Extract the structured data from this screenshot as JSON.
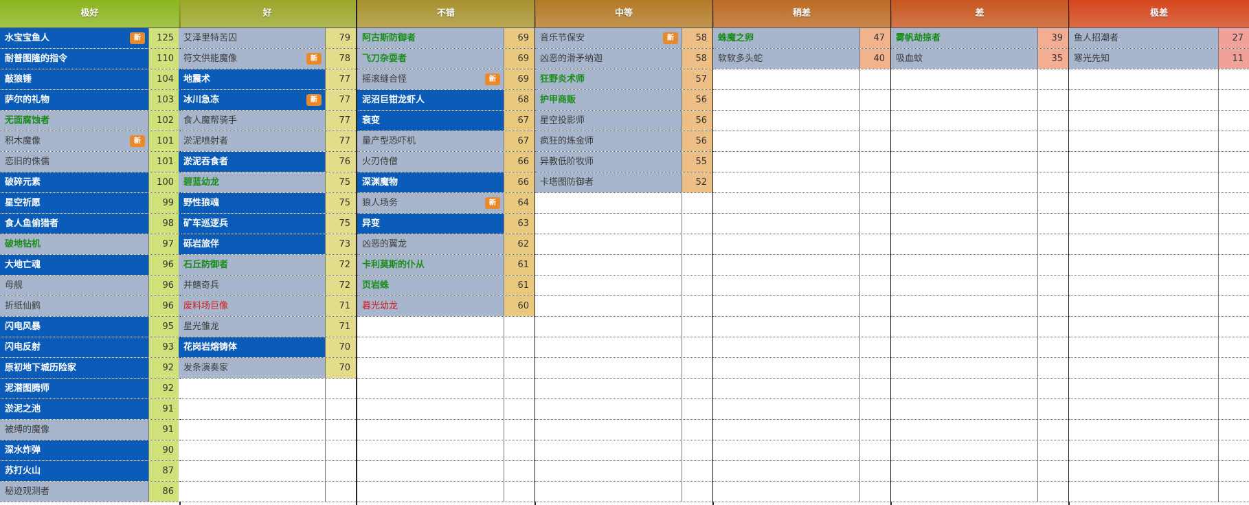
{
  "tiers": [
    {
      "label": "极好",
      "header_color": "#8cb51f",
      "score_bg": "#cfe27a",
      "items": [
        {
          "name": "水宝宝鱼人",
          "score": "125",
          "style": "blue",
          "color": "white",
          "new": true
        },
        {
          "name": "耐普图隆的指令",
          "score": "110",
          "style": "blue",
          "color": "white",
          "new": false
        },
        {
          "name": "敲狼锤",
          "score": "104",
          "style": "blue",
          "color": "white",
          "new": false
        },
        {
          "name": "萨尔的礼物",
          "score": "103",
          "style": "blue",
          "color": "white",
          "new": false
        },
        {
          "name": "无面腐蚀者",
          "score": "102",
          "style": "gray",
          "color": "green",
          "new": false
        },
        {
          "name": "积木魔像",
          "score": "101",
          "style": "gray",
          "color": "dark",
          "new": true
        },
        {
          "name": "恋旧的侏儒",
          "score": "101",
          "style": "gray",
          "color": "dark",
          "new": false
        },
        {
          "name": "破碎元素",
          "score": "100",
          "style": "blue",
          "color": "white",
          "new": false
        },
        {
          "name": "星空祈愿",
          "score": "99",
          "style": "blue",
          "color": "white",
          "new": false
        },
        {
          "name": "食人鱼偷猎者",
          "score": "98",
          "style": "blue",
          "color": "white",
          "new": false
        },
        {
          "name": "破地钻机",
          "score": "97",
          "style": "gray",
          "color": "green",
          "new": false
        },
        {
          "name": "大地亡魂",
          "score": "96",
          "style": "blue",
          "color": "white",
          "new": false
        },
        {
          "name": "母舰",
          "score": "96",
          "style": "gray",
          "color": "dark",
          "new": false
        },
        {
          "name": "折纸仙鹤",
          "score": "96",
          "style": "gray",
          "color": "dark",
          "new": false
        },
        {
          "name": "闪电风暴",
          "score": "95",
          "style": "blue",
          "color": "white",
          "new": false
        },
        {
          "name": "闪电反射",
          "score": "93",
          "style": "blue",
          "color": "white",
          "new": false
        },
        {
          "name": "原初地下城历险家",
          "score": "92",
          "style": "blue",
          "color": "white",
          "new": false
        },
        {
          "name": "泥潜图腾师",
          "score": "92",
          "style": "blue",
          "color": "white",
          "new": false
        },
        {
          "name": "淤泥之池",
          "score": "91",
          "style": "blue",
          "color": "white",
          "new": false
        },
        {
          "name": "被缚的魔像",
          "score": "91",
          "style": "gray",
          "color": "dark",
          "new": false
        },
        {
          "name": "深水炸弹",
          "score": "90",
          "style": "blue",
          "color": "white",
          "new": false
        },
        {
          "name": "苏打火山",
          "score": "87",
          "style": "blue",
          "color": "white",
          "new": false
        },
        {
          "name": "秘迹观测者",
          "score": "86",
          "style": "gray",
          "color": "dark",
          "new": false
        }
      ]
    },
    {
      "label": "好",
      "header_color": "#9aa62a",
      "score_bg": "#e3dc8a",
      "items": [
        {
          "name": "艾泽里特苦囚",
          "score": "79",
          "style": "gray",
          "color": "dark",
          "new": false
        },
        {
          "name": "符文供能魔像",
          "score": "78",
          "style": "gray",
          "color": "dark",
          "new": true
        },
        {
          "name": "地震术",
          "score": "77",
          "style": "blue",
          "color": "white",
          "new": false
        },
        {
          "name": "冰川急冻",
          "score": "77",
          "style": "blue",
          "color": "white",
          "new": true
        },
        {
          "name": "食人魔帮骑手",
          "score": "77",
          "style": "gray",
          "color": "dark",
          "new": false
        },
        {
          "name": "淤泥喷射者",
          "score": "77",
          "style": "gray",
          "color": "dark",
          "new": false
        },
        {
          "name": "淤泥吞食者",
          "score": "76",
          "style": "blue",
          "color": "white",
          "new": false
        },
        {
          "name": "碧蓝幼龙",
          "score": "75",
          "style": "gray",
          "color": "green",
          "new": false
        },
        {
          "name": "野性狼魂",
          "score": "75",
          "style": "blue",
          "color": "white",
          "new": false
        },
        {
          "name": "矿车巡逻兵",
          "score": "75",
          "style": "blue",
          "color": "white",
          "new": false
        },
        {
          "name": "砾岩旅伴",
          "score": "73",
          "style": "blue",
          "color": "white",
          "new": false
        },
        {
          "name": "石丘防御者",
          "score": "72",
          "style": "gray",
          "color": "green",
          "new": false
        },
        {
          "name": "并鳍奇兵",
          "score": "72",
          "style": "gray",
          "color": "dark",
          "new": false
        },
        {
          "name": "废料场巨像",
          "score": "71",
          "style": "gray",
          "color": "red",
          "new": false
        },
        {
          "name": "星光雏龙",
          "score": "71",
          "style": "gray",
          "color": "dark",
          "new": false
        },
        {
          "name": "花岗岩熔铸体",
          "score": "70",
          "style": "blue",
          "color": "white",
          "new": false
        },
        {
          "name": "发条演奏家",
          "score": "70",
          "style": "gray",
          "color": "dark",
          "new": false
        }
      ]
    },
    {
      "label": "不错",
      "header_color": "#a8922e",
      "score_bg": "#e9c97e",
      "items": [
        {
          "name": "阿古斯防御者",
          "score": "69",
          "style": "gray",
          "color": "green",
          "new": false
        },
        {
          "name": "飞刀杂耍者",
          "score": "69",
          "style": "gray",
          "color": "green",
          "new": false
        },
        {
          "name": "摇滚缝合怪",
          "score": "69",
          "style": "gray",
          "color": "dark",
          "new": true
        },
        {
          "name": "泥沼巨钳龙虾人",
          "score": "68",
          "style": "blue",
          "color": "white",
          "new": false
        },
        {
          "name": "衰变",
          "score": "67",
          "style": "blue",
          "color": "white",
          "new": false
        },
        {
          "name": "量产型恐吓机",
          "score": "67",
          "style": "gray",
          "color": "dark",
          "new": false
        },
        {
          "name": "火刃侍僧",
          "score": "66",
          "style": "gray",
          "color": "dark",
          "new": false
        },
        {
          "name": "深渊魔物",
          "score": "66",
          "style": "blue",
          "color": "white",
          "new": false
        },
        {
          "name": "狼人场务",
          "score": "64",
          "style": "gray",
          "color": "dark",
          "new": true
        },
        {
          "name": "异变",
          "score": "63",
          "style": "blue",
          "color": "white",
          "new": false
        },
        {
          "name": "凶恶的翼龙",
          "score": "62",
          "style": "gray",
          "color": "dark",
          "new": false
        },
        {
          "name": "卡利莫斯的仆从",
          "score": "61",
          "style": "gray",
          "color": "green",
          "new": false
        },
        {
          "name": "页岩蛛",
          "score": "61",
          "style": "gray",
          "color": "green",
          "new": false
        },
        {
          "name": "暮光幼龙",
          "score": "60",
          "style": "gray",
          "color": "red",
          "new": false
        }
      ]
    },
    {
      "label": "中等",
      "header_color": "#b27a26",
      "score_bg": "#eebf85",
      "items": [
        {
          "name": "音乐节保安",
          "score": "58",
          "style": "gray",
          "color": "dark",
          "new": true
        },
        {
          "name": "凶恶的滑矛纳迦",
          "score": "58",
          "style": "gray",
          "color": "dark",
          "new": false
        },
        {
          "name": "狂野炎术师",
          "score": "57",
          "style": "gray",
          "color": "green",
          "new": false
        },
        {
          "name": "护甲商贩",
          "score": "56",
          "style": "gray",
          "color": "green",
          "new": false
        },
        {
          "name": "星空投影师",
          "score": "56",
          "style": "gray",
          "color": "dark",
          "new": false
        },
        {
          "name": "疯狂的炼金师",
          "score": "56",
          "style": "gray",
          "color": "dark",
          "new": false
        },
        {
          "name": "异教低阶牧师",
          "score": "55",
          "style": "gray",
          "color": "dark",
          "new": false
        },
        {
          "name": "卡塔图防御者",
          "score": "52",
          "style": "gray",
          "color": "dark",
          "new": false
        }
      ]
    },
    {
      "label": "稍差",
      "header_color": "#bb6a22",
      "score_bg": "#f0b38c",
      "items": [
        {
          "name": "蛛魔之卵",
          "score": "47",
          "style": "gray",
          "color": "green",
          "new": false
        },
        {
          "name": "软软多头蛇",
          "score": "40",
          "style": "gray",
          "color": "dark",
          "new": false
        }
      ]
    },
    {
      "label": "差",
      "header_color": "#c7561f",
      "score_bg": "#f2ad93",
      "items": [
        {
          "name": "雾帆劫掠者",
          "score": "39",
          "style": "gray",
          "color": "green",
          "new": false
        },
        {
          "name": "吸血蚊",
          "score": "35",
          "style": "gray",
          "color": "dark",
          "new": false
        }
      ]
    },
    {
      "label": "极差",
      "header_color": "#d3461c",
      "score_bg": "#f0a29a",
      "items": [
        {
          "name": "鱼人招潮者",
          "score": "27",
          "style": "gray",
          "color": "dark",
          "new": false
        },
        {
          "name": "寒光先知",
          "score": "11",
          "style": "gray",
          "color": "dark",
          "new": false
        }
      ]
    }
  ],
  "new_badge_label": "新"
}
